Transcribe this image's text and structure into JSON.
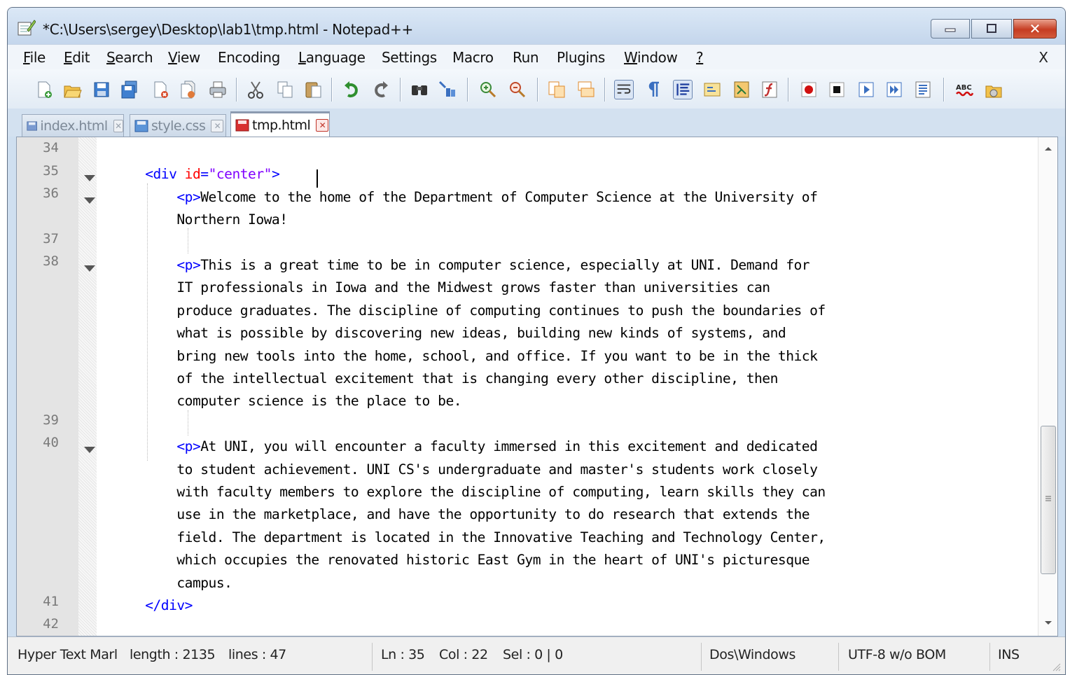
{
  "window": {
    "title": "*C:\\Users\\sergey\\Desktop\\lab1\\tmp.html - Notepad++",
    "close_glyph": "✕"
  },
  "menu": {
    "items": [
      {
        "mnemonic": "F",
        "rest": "ile"
      },
      {
        "mnemonic": "E",
        "rest": "dit"
      },
      {
        "mnemonic": "S",
        "rest": "earch"
      },
      {
        "mnemonic": "V",
        "rest": "iew"
      },
      {
        "mnemonic": "",
        "rest": "Encoding"
      },
      {
        "mnemonic": "L",
        "rest": "anguage"
      },
      {
        "mnemonic": "",
        "rest": "Settings"
      },
      {
        "mnemonic": "",
        "rest": "Macro"
      },
      {
        "mnemonic": "",
        "rest": "Run"
      },
      {
        "mnemonic": "",
        "rest": "Plugins"
      },
      {
        "mnemonic": "W",
        "rest": "indow"
      },
      {
        "mnemonic": "?",
        "rest": ""
      }
    ],
    "close_doc": "X"
  },
  "toolbar": {
    "icons": [
      "new-file-icon",
      "open-file-icon",
      "save-icon",
      "save-all-icon",
      "close-icon",
      "close-all-icon",
      "print-icon",
      "cut-icon",
      "copy-icon",
      "paste-icon",
      "undo-icon",
      "redo-icon",
      "find-icon",
      "replace-icon",
      "zoom-in-icon",
      "zoom-out-icon",
      "sync-vertical-icon",
      "sync-horizontal-icon",
      "word-wrap-icon",
      "show-all-chars-icon",
      "indent-guide-icon",
      "user-language-icon",
      "document-map-icon",
      "function-list-icon",
      "record-macro-icon",
      "stop-record-icon",
      "play-macro-icon",
      "run-macro-multiple-icon",
      "save-macro-icon",
      "spell-check-icon",
      "plugin-icon"
    ]
  },
  "tabs": [
    {
      "label": "index.html",
      "close": "✕",
      "state": "saved"
    },
    {
      "label": "style.css",
      "close": "✕",
      "state": "saved"
    },
    {
      "label": "tmp.html",
      "close": "✕",
      "state": "modified"
    }
  ],
  "editor": {
    "line_numbers": [
      "34",
      "35",
      "36",
      "37",
      "38",
      "39",
      "40",
      "41",
      "42"
    ],
    "code_lines": [
      "",
      "    <div id=\"center\">",
      "        <p>Welcome to the home of the Department of Computer Science at the University of",
      "        Northern Iowa!",
      "",
      "        <p>This is a great time to be in computer science, especially at UNI. Demand for",
      "        IT professionals in Iowa and the Midwest grows faster than universities can",
      "        produce graduates. The discipline of computing continues to push the boundaries of",
      "        what is possible by discovering new ideas, building new kinds of systems, and",
      "        bring new tools into the home, school, and office. If you want to be in the thick",
      "        of the intellectual excitement that is changing every other discipline, then",
      "        computer science is the place to be.",
      "",
      "        <p>At UNI, you will encounter a faculty immersed in this excitement and dedicated",
      "        to student achievement. UNI CS's undergraduate and master's students work closely",
      "        with faculty members to explore the discipline of computing, learn skills they can",
      "        use in the marketplace, and have the opportunity to do research that extends the",
      "        field. The department is located in the Innovative Teaching and Technology Center,",
      "        which occupies the renovated historic East Gym in the heart of UNI's picturesque",
      "        campus.",
      "    </div>",
      ""
    ]
  },
  "statusbar": {
    "language": "Hyper Text Marl",
    "length": "length : 2135",
    "lines": "lines : 47",
    "ln": "Ln : 35",
    "col": "Col : 22",
    "sel": "Sel : 0 | 0",
    "eol": "Dos\\Windows",
    "encoding": "UTF-8 w/o BOM",
    "mode": "INS"
  },
  "colors": {
    "tag": "#0000ff",
    "attribute": "#ff0000",
    "value": "#8000ff",
    "active_tab_accent": "#f2a33a"
  }
}
